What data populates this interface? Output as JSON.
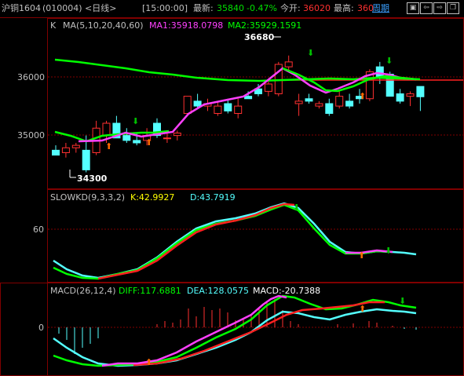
{
  "header": {
    "symbol": "沪铜1604",
    "code": "(010004)",
    "period": "<日线>",
    "time": "[15:00:00]",
    "latest_label": "最新:",
    "latest_value": "35840",
    "change": "-0.47%",
    "open_label": "今开:",
    "open_value": "36020",
    "high_label": "最高:",
    "high_value": "360",
    "cycle_label": "周期",
    "buttons": [
      "box",
      "left",
      "right",
      "restore"
    ]
  },
  "panels": {
    "kline": {
      "legend_prefix": "K",
      "legend_ma": "MA(5,10,20,40,60)",
      "legend_ma1": "MA1:35918.0798",
      "legend_ma2": "MA2:35929.1591",
      "y_ticks": [
        "36000",
        "35000"
      ],
      "high_marker": "36680",
      "low_marker": "34300"
    },
    "kd": {
      "legend": "SLOWKD(9,3,3,2)",
      "k_value": "K:42.9927",
      "d_value": "D:43.7919",
      "y_ticks": [
        "60"
      ]
    },
    "macd": {
      "legend": "MACD(26,12,4)",
      "diff": "DIFF:117.6881",
      "dea": "DEA:128.0575",
      "macd": "MACD:-20.7388",
      "y_ticks": [
        "0"
      ]
    }
  },
  "colors": {
    "up": "#ff3030",
    "down": "#54ffff",
    "ma1": "#ff40ff",
    "ma2": "#00ff00",
    "ma_long": "#ff2020",
    "grid": "#800000",
    "text": "#c0c0c0",
    "red_text": "#ff3030",
    "green_text": "#00e000",
    "cyan_text": "#54ffff",
    "yellow_text": "#ffff00",
    "blue_text": "#3aa0ff"
  },
  "chart_data": {
    "type": "candlestick",
    "y_range": [
      34100,
      36900
    ],
    "candles": [
      {
        "o": 34750,
        "h": 34850,
        "l": 34650,
        "c": 34650
      },
      {
        "o": 34700,
        "h": 34900,
        "l": 34600,
        "c": 34800
      },
      {
        "o": 34800,
        "h": 34900,
        "l": 34700,
        "c": 34850
      },
      {
        "o": 34750,
        "h": 35050,
        "l": 34300,
        "c": 34350
      },
      {
        "o": 34700,
        "h": 35350,
        "l": 34650,
        "c": 35200
      },
      {
        "o": 35050,
        "h": 35350,
        "l": 34900,
        "c": 35300
      },
      {
        "o": 35300,
        "h": 35450,
        "l": 35200,
        "c": 35000
      },
      {
        "o": 35050,
        "h": 35200,
        "l": 34900,
        "c": 34950
      },
      {
        "o": 34950,
        "h": 35100,
        "l": 34850,
        "c": 34900
      },
      {
        "o": 34950,
        "h": 35200,
        "l": 34850,
        "c": 35050
      },
      {
        "o": 35300,
        "h": 35400,
        "l": 35000,
        "c": 35050
      },
      {
        "o": 35000,
        "h": 35100,
        "l": 34900,
        "c": 35000
      },
      {
        "o": 35050,
        "h": 35150,
        "l": 34950,
        "c": 35100
      },
      {
        "o": 35500,
        "h": 35700,
        "l": 35450,
        "c": 35850
      },
      {
        "o": 35750,
        "h": 35900,
        "l": 35600,
        "c": 35650
      },
      {
        "o": 35650,
        "h": 35800,
        "l": 35550,
        "c": 35700
      },
      {
        "o": 35500,
        "h": 35750,
        "l": 35450,
        "c": 35650
      },
      {
        "o": 35700,
        "h": 35800,
        "l": 35500,
        "c": 35550
      },
      {
        "o": 35500,
        "h": 35800,
        "l": 35400,
        "c": 35650
      },
      {
        "o": 35850,
        "h": 35950,
        "l": 35800,
        "c": 35800
      },
      {
        "o": 36000,
        "h": 36100,
        "l": 35850,
        "c": 35900
      },
      {
        "o": 35950,
        "h": 36150,
        "l": 35850,
        "c": 36100
      },
      {
        "o": 35900,
        "h": 36550,
        "l": 35850,
        "c": 36500
      },
      {
        "o": 36450,
        "h": 36680,
        "l": 36350,
        "c": 36550
      },
      {
        "o": 35700,
        "h": 35900,
        "l": 35450,
        "c": 35750
      },
      {
        "o": 35800,
        "h": 35900,
        "l": 35700,
        "c": 35750
      },
      {
        "o": 35650,
        "h": 35750,
        "l": 35600,
        "c": 35700
      },
      {
        "o": 35700,
        "h": 35800,
        "l": 35450,
        "c": 35500
      },
      {
        "o": 35650,
        "h": 35950,
        "l": 35600,
        "c": 35850
      },
      {
        "o": 35750,
        "h": 35900,
        "l": 35600,
        "c": 35650
      },
      {
        "o": 35850,
        "h": 36000,
        "l": 35700,
        "c": 35800
      },
      {
        "o": 35800,
        "h": 36400,
        "l": 35750,
        "c": 36350
      },
      {
        "o": 36450,
        "h": 36550,
        "l": 36100,
        "c": 36250
      },
      {
        "o": 36300,
        "h": 36350,
        "l": 35850,
        "c": 35850
      },
      {
        "o": 35900,
        "h": 36000,
        "l": 35700,
        "c": 35750
      },
      {
        "o": 35850,
        "h": 35950,
        "l": 35650,
        "c": 35900
      },
      {
        "o": 36050,
        "h": 36050,
        "l": 35550,
        "c": 35840
      }
    ]
  }
}
